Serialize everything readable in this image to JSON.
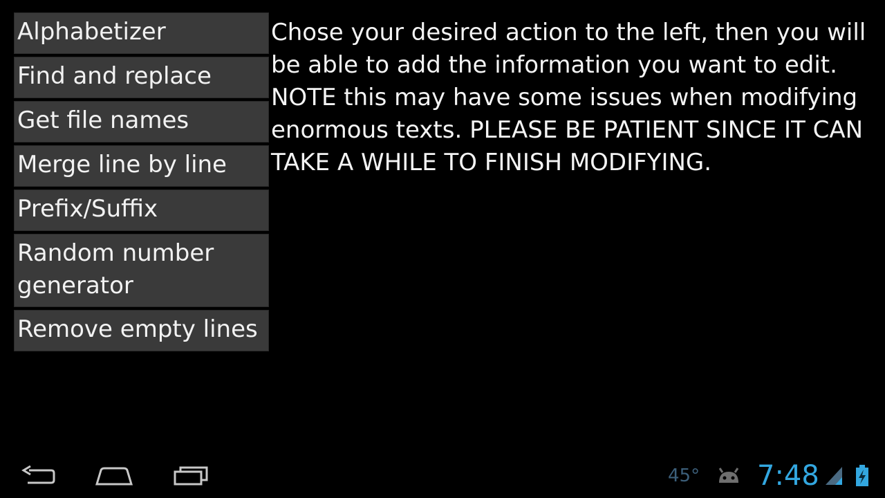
{
  "menu": {
    "items": [
      {
        "label": "Alphabetizer"
      },
      {
        "label": "Find and replace"
      },
      {
        "label": "Get file names"
      },
      {
        "label": "Merge line by line"
      },
      {
        "label": "Prefix/Suffix"
      },
      {
        "label": "Random number generator"
      },
      {
        "label": "Remove empty lines"
      }
    ]
  },
  "info": {
    "text": "Chose your desired action to the left, then you will be able to add the information you want to edit. NOTE this may have some issues when modifying enormous texts. PLEASE BE PATIENT SINCE IT CAN TAKE A WHILE TO FINISH MODIFYING."
  },
  "navbar": {
    "back_icon": "back-icon",
    "home_icon": "home-icon",
    "recents_icon": "recent-apps-icon"
  },
  "status": {
    "temperature": "45°",
    "time": "7:48",
    "accent_color": "#33a7e0",
    "icons": [
      "android-debug-icon",
      "signal-icon",
      "battery-charging-icon"
    ]
  }
}
